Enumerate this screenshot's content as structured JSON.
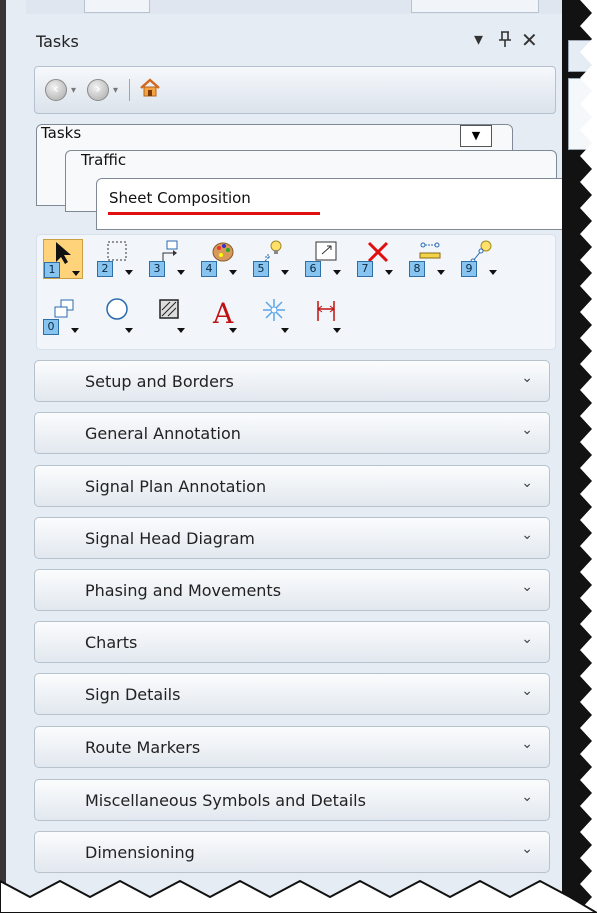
{
  "pane": {
    "title": "Tasks",
    "controls": {
      "dropdown": "▾",
      "pin": "ᅠ",
      "close": "✕"
    }
  },
  "nav": {
    "back_icon": "arrow-left-circle-icon",
    "forward_icon": "arrow-right-circle-icon",
    "home_icon": "home-icon"
  },
  "tabs": {
    "tasks": "Tasks",
    "traffic": "Traffic",
    "sheet_composition": "Sheet Composition"
  },
  "tools_row1": [
    {
      "num": "1",
      "icon": "arrow-select-icon"
    },
    {
      "num": "2",
      "icon": "dashed-rectangle-select-icon"
    },
    {
      "num": "3",
      "icon": "move-element-icon"
    },
    {
      "num": "4",
      "icon": "palette-attributes-icon"
    },
    {
      "num": "5",
      "icon": "lightbulb-burst-icon"
    },
    {
      "num": "6",
      "icon": "scale-box-icon"
    },
    {
      "num": "7",
      "icon": "red-x-delete-icon"
    },
    {
      "num": "8",
      "icon": "measure-line-icon"
    },
    {
      "num": "9",
      "icon": "lightbulb-node-icon"
    }
  ],
  "tools_row2": [
    {
      "num": "0",
      "icon": "group-shapes-icon"
    },
    {
      "num": "",
      "icon": "circle-icon"
    },
    {
      "num": "",
      "icon": "hatch-pattern-icon"
    },
    {
      "num": "",
      "icon": "text-a-icon"
    },
    {
      "num": "",
      "icon": "sparkle-star-icon"
    },
    {
      "num": "",
      "icon": "dimension-icon"
    }
  ],
  "tool_letter_a": "A",
  "sections": [
    "Setup and Borders",
    "General Annotation",
    "Signal Plan Annotation",
    "Signal Head Diagram",
    "Phasing and Movements",
    "Charts",
    "Sign Details",
    "Route Markers",
    "Miscellaneous Symbols and Details",
    "Dimensioning"
  ],
  "chevron": "❯"
}
